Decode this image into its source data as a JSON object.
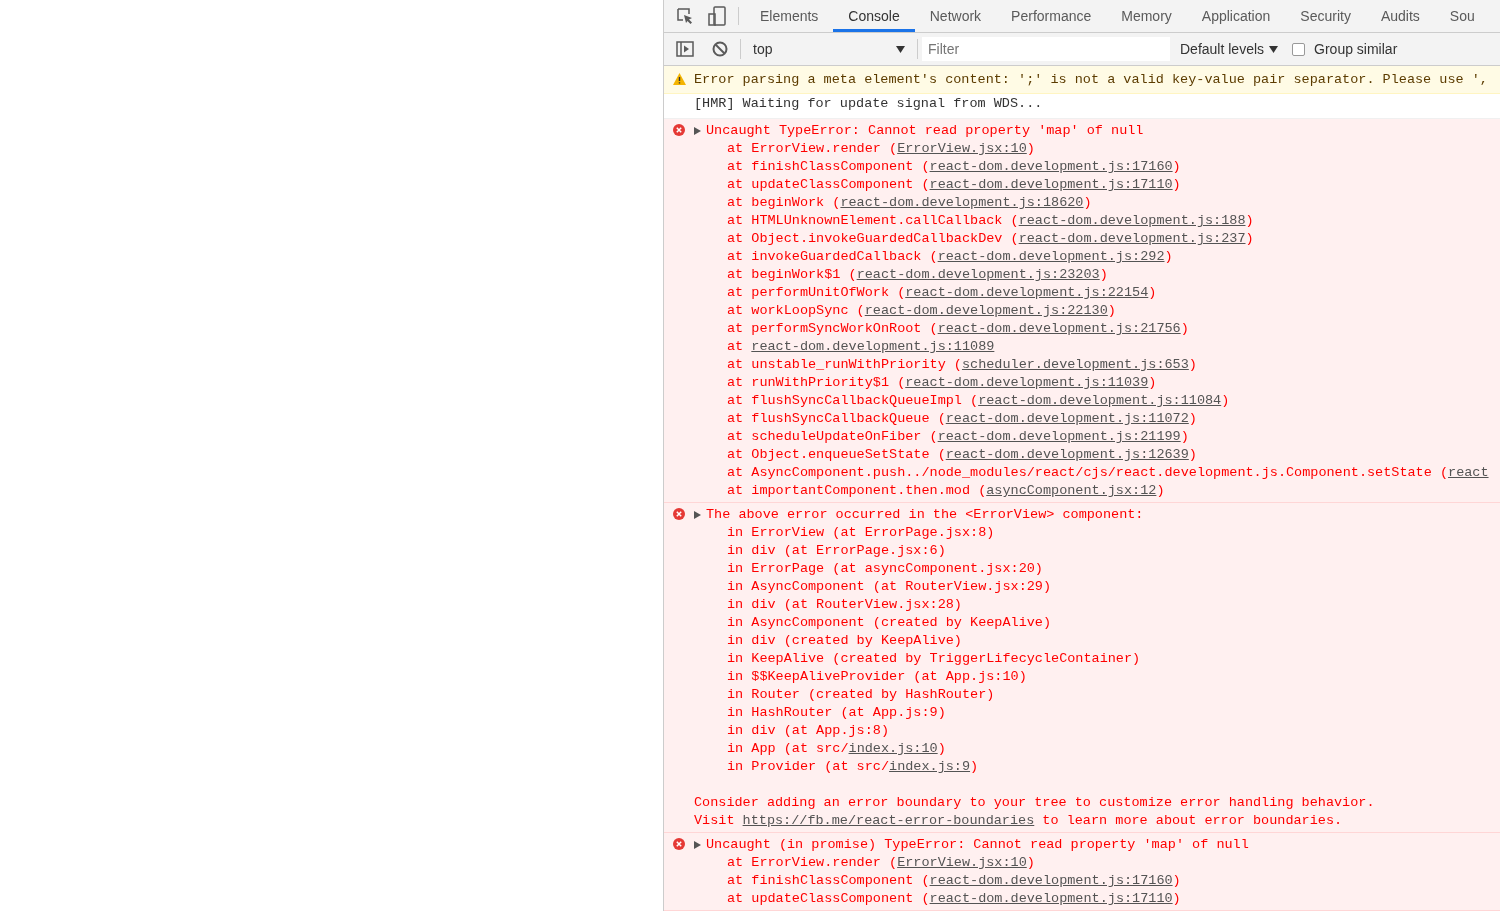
{
  "tabs": [
    {
      "label": "Elements",
      "selected": false
    },
    {
      "label": "Console",
      "selected": true
    },
    {
      "label": "Network",
      "selected": false
    },
    {
      "label": "Performance",
      "selected": false
    },
    {
      "label": "Memory",
      "selected": false
    },
    {
      "label": "Application",
      "selected": false
    },
    {
      "label": "Security",
      "selected": false
    },
    {
      "label": "Audits",
      "selected": false
    },
    {
      "label": "Sou",
      "selected": false
    }
  ],
  "toolbar": {
    "context": "top",
    "filter": {
      "placeholder": "Filter"
    },
    "levels": "Default levels",
    "group_similar": {
      "label": "Group similar",
      "checked": false
    }
  },
  "entries": [
    {
      "kind": "warning",
      "text": "Error parsing a meta element's content: ';' is not a valid key-value pair separator. Please use ',"
    },
    {
      "kind": "log",
      "text": "[HMR] Waiting for update signal from WDS..."
    },
    {
      "kind": "error",
      "expanded": false,
      "message": "Uncaught TypeError: Cannot read property 'map' of null",
      "lines": [
        {
          "prefix": "at ErrorView.render (",
          "link": "ErrorView.jsx:10",
          "suffix": ")"
        },
        {
          "prefix": "at finishClassComponent (",
          "link": "react-dom.development.js:17160",
          "suffix": ")"
        },
        {
          "prefix": "at updateClassComponent (",
          "link": "react-dom.development.js:17110",
          "suffix": ")"
        },
        {
          "prefix": "at beginWork (",
          "link": "react-dom.development.js:18620",
          "suffix": ")"
        },
        {
          "prefix": "at HTMLUnknownElement.callCallback (",
          "link": "react-dom.development.js:188",
          "suffix": ")"
        },
        {
          "prefix": "at Object.invokeGuardedCallbackDev (",
          "link": "react-dom.development.js:237",
          "suffix": ")"
        },
        {
          "prefix": "at invokeGuardedCallback (",
          "link": "react-dom.development.js:292",
          "suffix": ")"
        },
        {
          "prefix": "at beginWork$1 (",
          "link": "react-dom.development.js:23203",
          "suffix": ")"
        },
        {
          "prefix": "at performUnitOfWork (",
          "link": "react-dom.development.js:22154",
          "suffix": ")"
        },
        {
          "prefix": "at workLoopSync (",
          "link": "react-dom.development.js:22130",
          "suffix": ")"
        },
        {
          "prefix": "at performSyncWorkOnRoot (",
          "link": "react-dom.development.js:21756",
          "suffix": ")"
        },
        {
          "prefix": "at ",
          "link": "react-dom.development.js:11089"
        },
        {
          "prefix": "at unstable_runWithPriority (",
          "link": "scheduler.development.js:653",
          "suffix": ")"
        },
        {
          "prefix": "at runWithPriority$1 (",
          "link": "react-dom.development.js:11039",
          "suffix": ")"
        },
        {
          "prefix": "at flushSyncCallbackQueueImpl (",
          "link": "react-dom.development.js:11084",
          "suffix": ")"
        },
        {
          "prefix": "at flushSyncCallbackQueue (",
          "link": "react-dom.development.js:11072",
          "suffix": ")"
        },
        {
          "prefix": "at scheduleUpdateOnFiber (",
          "link": "react-dom.development.js:21199",
          "suffix": ")"
        },
        {
          "prefix": "at Object.enqueueSetState (",
          "link": "react-dom.development.js:12639",
          "suffix": ")"
        },
        {
          "prefix": "at AsyncComponent.push../node_modules/react/cjs/react.development.js.Component.setState (",
          "link": "react"
        },
        {
          "prefix": "at importantComponent.then.mod (",
          "link": "asyncComponent.jsx:12",
          "suffix": ")"
        }
      ]
    },
    {
      "kind": "error",
      "expanded": false,
      "message": "The above error occurred in the <ErrorView> component:",
      "lines": [
        {
          "prefix": "in ErrorView (at ErrorPage.jsx:8)"
        },
        {
          "prefix": "in div (at ErrorPage.jsx:6)"
        },
        {
          "prefix": "in ErrorPage (at asyncComponent.jsx:20)"
        },
        {
          "prefix": "in AsyncComponent (at RouterView.jsx:29)"
        },
        {
          "prefix": "in div (at RouterView.jsx:28)"
        },
        {
          "prefix": "in AsyncComponent (created by KeepAlive)"
        },
        {
          "prefix": "in div (created by KeepAlive)"
        },
        {
          "prefix": "in KeepAlive (created by TriggerLifecycleContainer)"
        },
        {
          "prefix": "in $$KeepAliveProvider (at App.js:10)"
        },
        {
          "prefix": "in Router (created by HashRouter)"
        },
        {
          "prefix": "in HashRouter (at App.js:9)"
        },
        {
          "prefix": "in div (at App.js:8)"
        },
        {
          "prefix": "in App (at src/",
          "link": "index.js:10",
          "suffix": ")"
        },
        {
          "prefix": "in Provider (at src/",
          "link": "index.js:9",
          "suffix": ")"
        }
      ],
      "notes": [
        {
          "prefix": "Consider adding an error boundary to your tree to customize error handling behavior."
        },
        {
          "prefix": "Visit ",
          "link": "https://fb.me/react-error-boundaries",
          "suffix": " to learn more about error boundaries."
        }
      ]
    },
    {
      "kind": "error",
      "expanded": false,
      "message": "Uncaught (in promise) TypeError: Cannot read property 'map' of null",
      "lines": [
        {
          "prefix": "at ErrorView.render (",
          "link": "ErrorView.jsx:10",
          "suffix": ")"
        },
        {
          "prefix": "at finishClassComponent (",
          "link": "react-dom.development.js:17160",
          "suffix": ")"
        },
        {
          "prefix": "at updateClassComponent (",
          "link": "react-dom.development.js:17110",
          "suffix": ")"
        }
      ]
    }
  ]
}
